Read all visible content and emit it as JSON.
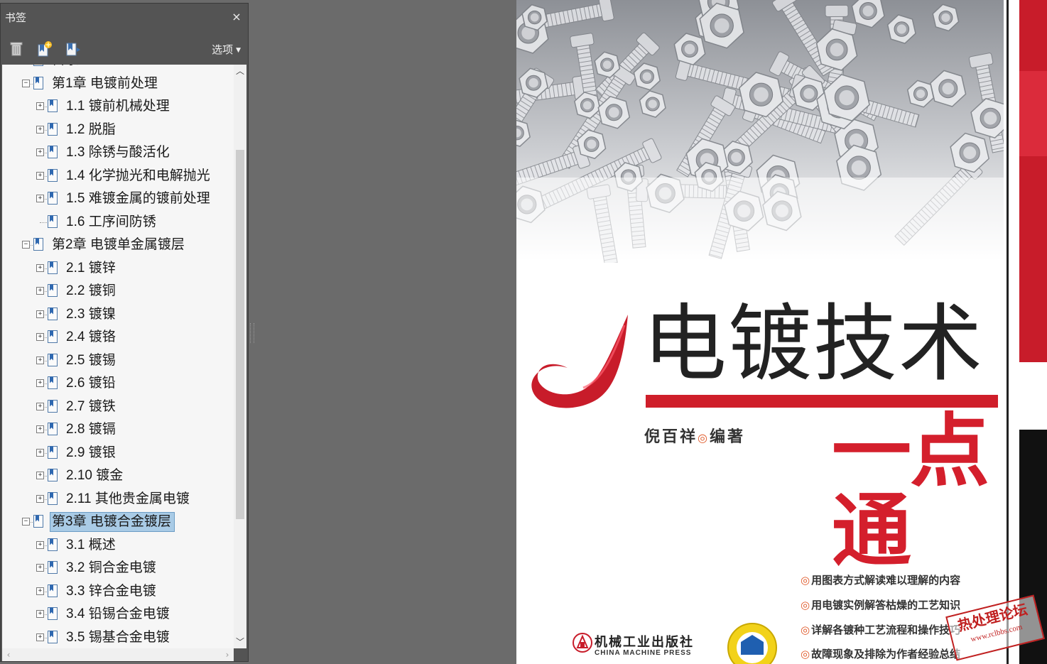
{
  "panel": {
    "title": "书签",
    "close_glyph": "×",
    "options_label": "选项",
    "toolbar": [
      "trash-icon",
      "new-bookmark-icon",
      "bookmark-export-icon"
    ]
  },
  "tree": [
    {
      "label": "目录",
      "level": 0,
      "expander": "",
      "selected": false
    },
    {
      "label": "第1章  电镀前处理",
      "level": 0,
      "expander": "−",
      "selected": false
    },
    {
      "label": "1.1  镀前机械处理",
      "level": 1,
      "expander": "+",
      "selected": false
    },
    {
      "label": "1.2  脱脂",
      "level": 1,
      "expander": "+",
      "selected": false
    },
    {
      "label": "1.3  除锈与酸活化",
      "level": 1,
      "expander": "+",
      "selected": false
    },
    {
      "label": "1.4  化学抛光和电解抛光",
      "level": 1,
      "expander": "+",
      "selected": false
    },
    {
      "label": "1.5  难镀金属的镀前处理",
      "level": 1,
      "expander": "+",
      "selected": false
    },
    {
      "label": "1.6  工序间防锈",
      "level": 1,
      "expander": "",
      "selected": false
    },
    {
      "label": "第2章  电镀单金属镀层",
      "level": 0,
      "expander": "−",
      "selected": false
    },
    {
      "label": "2.1  镀锌",
      "level": 1,
      "expander": "+",
      "selected": false
    },
    {
      "label": "2.2  镀铜",
      "level": 1,
      "expander": "+",
      "selected": false
    },
    {
      "label": "2.3  镀镍",
      "level": 1,
      "expander": "+",
      "selected": false
    },
    {
      "label": "2.4  镀铬",
      "level": 1,
      "expander": "+",
      "selected": false
    },
    {
      "label": "2.5  镀锡",
      "level": 1,
      "expander": "+",
      "selected": false
    },
    {
      "label": "2.6  镀铅",
      "level": 1,
      "expander": "+",
      "selected": false
    },
    {
      "label": "2.7  镀铁",
      "level": 1,
      "expander": "+",
      "selected": false
    },
    {
      "label": "2.8  镀镉",
      "level": 1,
      "expander": "+",
      "selected": false
    },
    {
      "label": "2.9  镀银",
      "level": 1,
      "expander": "+",
      "selected": false
    },
    {
      "label": "2.10  镀金",
      "level": 1,
      "expander": "+",
      "selected": false
    },
    {
      "label": "2.11  其他贵金属电镀",
      "level": 1,
      "expander": "+",
      "selected": false
    },
    {
      "label": "第3章  电镀合金镀层",
      "level": 0,
      "expander": "−",
      "selected": true
    },
    {
      "label": "3.1  概述",
      "level": 1,
      "expander": "+",
      "selected": false
    },
    {
      "label": "3.2  铜合金电镀",
      "level": 1,
      "expander": "+",
      "selected": false
    },
    {
      "label": "3.3  锌合金电镀",
      "level": 1,
      "expander": "+",
      "selected": false
    },
    {
      "label": "3.4  铅锡合金电镀",
      "level": 1,
      "expander": "+",
      "selected": false
    },
    {
      "label": "3.5  锡基合金电镀",
      "level": 1,
      "expander": "+",
      "selected": false
    }
  ],
  "cover": {
    "title": "电镀技术",
    "subtitle": "一点通",
    "author": "倪百祥",
    "author_sep": "◎",
    "author_role": "编著",
    "bullets": [
      "用图表方式解读难以理解的内容",
      "用电镀实例解答枯燥的工艺知识",
      "详解各镀种工艺流程和操作技巧",
      "故障现象及排除为作者经验总结"
    ],
    "publisher_cn": "机械工业出版社",
    "publisher_en": "CHINA MACHINE PRESS",
    "watermark_cn": "热处理论坛",
    "watermark_url": "www.rclbbs.com"
  },
  "colors": {
    "panel_bg": "#545454",
    "tree_bg": "#f6f6f6",
    "selection": "#a9cbe6",
    "viewer_bg": "#6b6b6b",
    "cover_red": "#d41f2c"
  }
}
